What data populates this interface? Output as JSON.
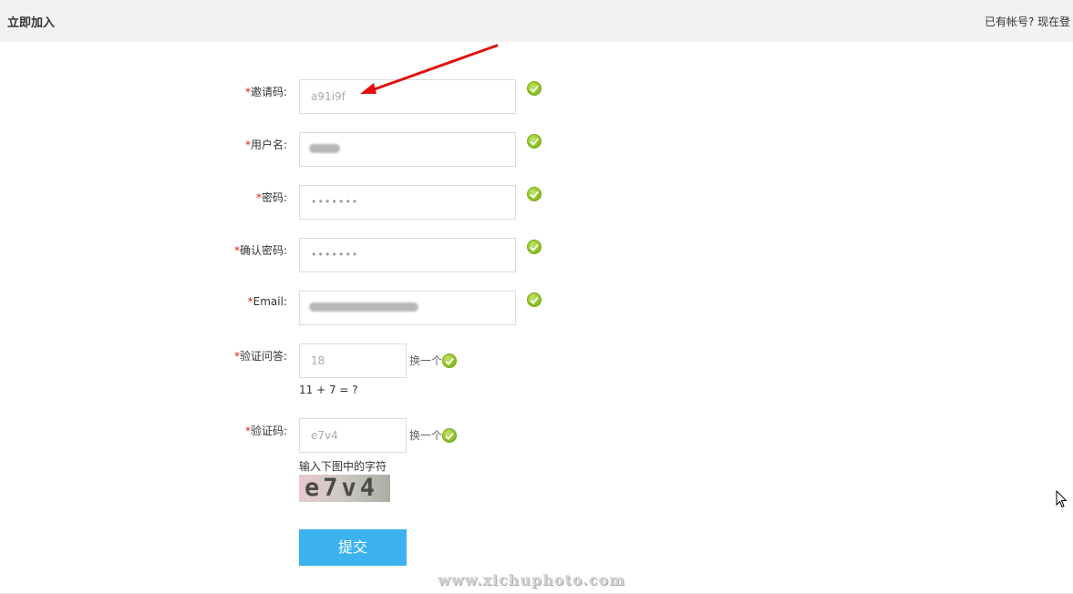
{
  "header": {
    "title": "立即加入",
    "login_hint": "已有帐号? 现在登"
  },
  "form": {
    "required_mark": "*",
    "invite_code": {
      "label": "邀请码:",
      "value": "a91i9f"
    },
    "username": {
      "label": "用户名:"
    },
    "password": {
      "label": "密码:",
      "value": "•••••••"
    },
    "confirm_password": {
      "label": "确认密码:",
      "value": "•••••••"
    },
    "email": {
      "label": "Email:"
    },
    "verify_question": {
      "label": "验证问答:",
      "value": "18",
      "switch_label": "换一个",
      "question": "11 + 7 = ?"
    },
    "captcha": {
      "label": "验证码:",
      "value": "e7v4",
      "switch_label": "换一个",
      "hint": "输入下图中的字符",
      "image_text": "e7v4"
    },
    "submit_label": "提交"
  },
  "watermark": "www.xichuphoto.com",
  "icons": {
    "valid": "check-circle-icon",
    "pointer": "mouse-cursor-icon",
    "annotation": "red-arrow"
  },
  "colors": {
    "required": "#e02020",
    "submit_bg": "#3cb3ef",
    "valid": "#8cc420",
    "annotation_arrow": "#e01010",
    "header_bg": "#f2f2f2"
  }
}
